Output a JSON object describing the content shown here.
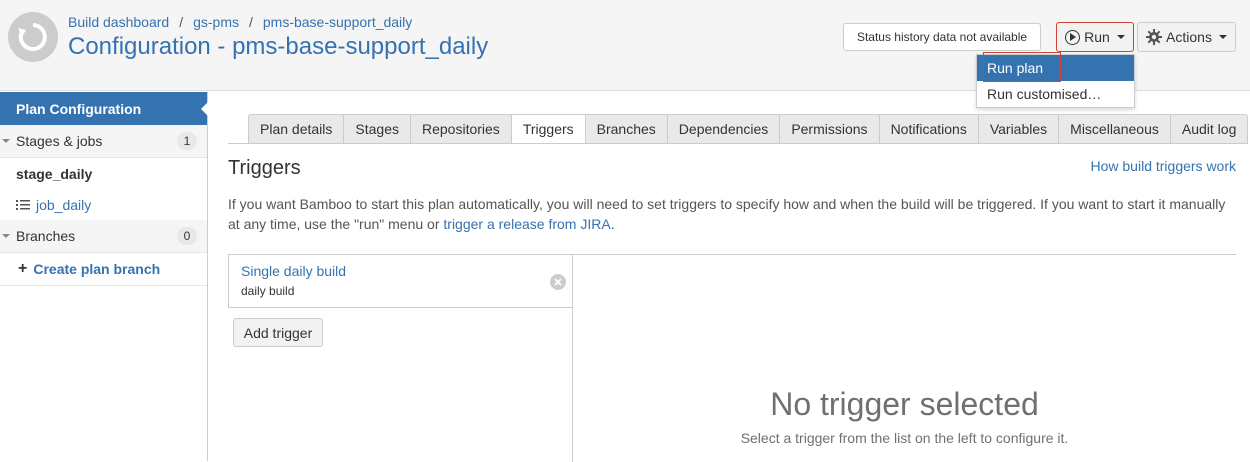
{
  "breadcrumb": [
    "Build dashboard",
    "gs-pms",
    "pms-base-support_daily"
  ],
  "page_title": "Configuration - pms-base-support_daily",
  "status_text": "Status history data not available",
  "run_button": "Run",
  "actions_button": "Actions",
  "run_menu": [
    "Run plan",
    "Run customised…"
  ],
  "sidebar": {
    "active": "Plan Configuration",
    "stages_label": "Stages & jobs",
    "stages_count": "1",
    "stage": "stage_daily",
    "job": "job_daily",
    "branches_label": "Branches",
    "branches_count": "0",
    "create_branch": "Create plan branch"
  },
  "tabs": [
    "Plan details",
    "Stages",
    "Repositories",
    "Triggers",
    "Branches",
    "Dependencies",
    "Permissions",
    "Notifications",
    "Variables",
    "Miscellaneous",
    "Audit log"
  ],
  "content": {
    "title": "Triggers",
    "help_link": "How build triggers work",
    "desc_before": "If you want Bamboo to start this plan automatically, you will need to set triggers to specify how and when the build will be triggered. If you want to start it manually at any time, use the \"run\" menu or ",
    "desc_link": "trigger a release from JIRA",
    "desc_after": ".",
    "trigger_name": "Single daily build",
    "trigger_desc": "daily build",
    "add_trigger": "Add trigger",
    "empty_title": "No trigger selected",
    "empty_sub": "Select a trigger from the list on the left to configure it."
  }
}
